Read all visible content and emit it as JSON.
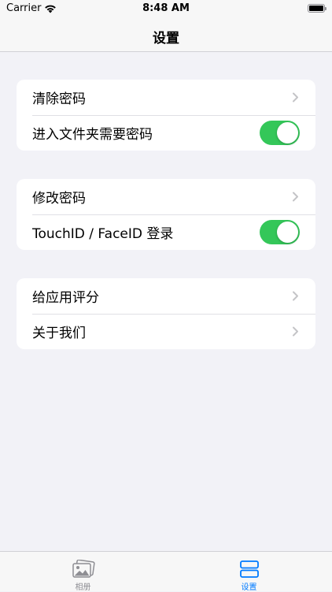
{
  "status_bar": {
    "carrier": "Carrier",
    "time": "8:48 AM",
    "wifi_icon": "wifi-icon",
    "battery_icon": "battery-icon",
    "battery_level": 1.0
  },
  "nav": {
    "title": "设置"
  },
  "groups": [
    {
      "rows": [
        {
          "label": "清除密码",
          "accessory": "chevron"
        },
        {
          "label": "进入文件夹需要密码",
          "accessory": "toggle",
          "on": true
        }
      ]
    },
    {
      "rows": [
        {
          "label": "修改密码",
          "accessory": "chevron"
        },
        {
          "label": "TouchID / FaceID 登录",
          "accessory": "toggle",
          "on": true
        }
      ]
    },
    {
      "rows": [
        {
          "label": "给应用评分",
          "accessory": "chevron"
        },
        {
          "label": "关于我们",
          "accessory": "chevron"
        }
      ]
    }
  ],
  "tab_bar": {
    "tabs": [
      {
        "label": "相册",
        "icon": "photos-icon",
        "selected": false
      },
      {
        "label": "设置",
        "icon": "settings-tab-icon",
        "selected": true
      }
    ]
  },
  "colors": {
    "background": "#f2f2f7",
    "toggle_on": "#34c759",
    "tab_selected": "#007aff",
    "tab_unselected": "#8e8e93",
    "chevron": "#c4c4c7"
  }
}
